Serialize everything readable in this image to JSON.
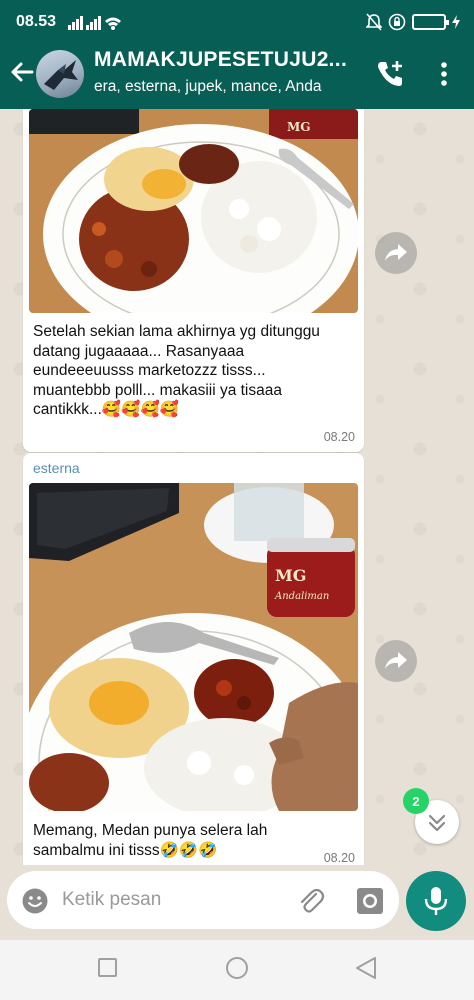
{
  "status_bar": {
    "time": "08.53"
  },
  "header": {
    "group_name": "MAMAKJUPESETUJU2...",
    "members": "era, esterna, jupek, mance, Anda"
  },
  "messages": [
    {
      "caption": "Setelah sekian lama akhirnya yg ditunggu datang jugaaaaa... Rasanyaaa eundeeeuusss marketozzz tisss... muantebbb polll... makasiii ya tisaaa cantikkk...🥰🥰🥰🥰",
      "time": "08.20"
    },
    {
      "sender": "esterna",
      "caption": "Memang, Medan punya selera lah sambalmu ini tisss🤣🤣🤣",
      "time": "08.20"
    }
  ],
  "photo_label": {
    "brand": "MG",
    "product": "Andaliman"
  },
  "unread_count": "2",
  "composer": {
    "placeholder": "Ketik pesan"
  },
  "theme": {
    "header_bg": "#075e54",
    "accent": "#128c7e",
    "badge": "#25d366"
  }
}
